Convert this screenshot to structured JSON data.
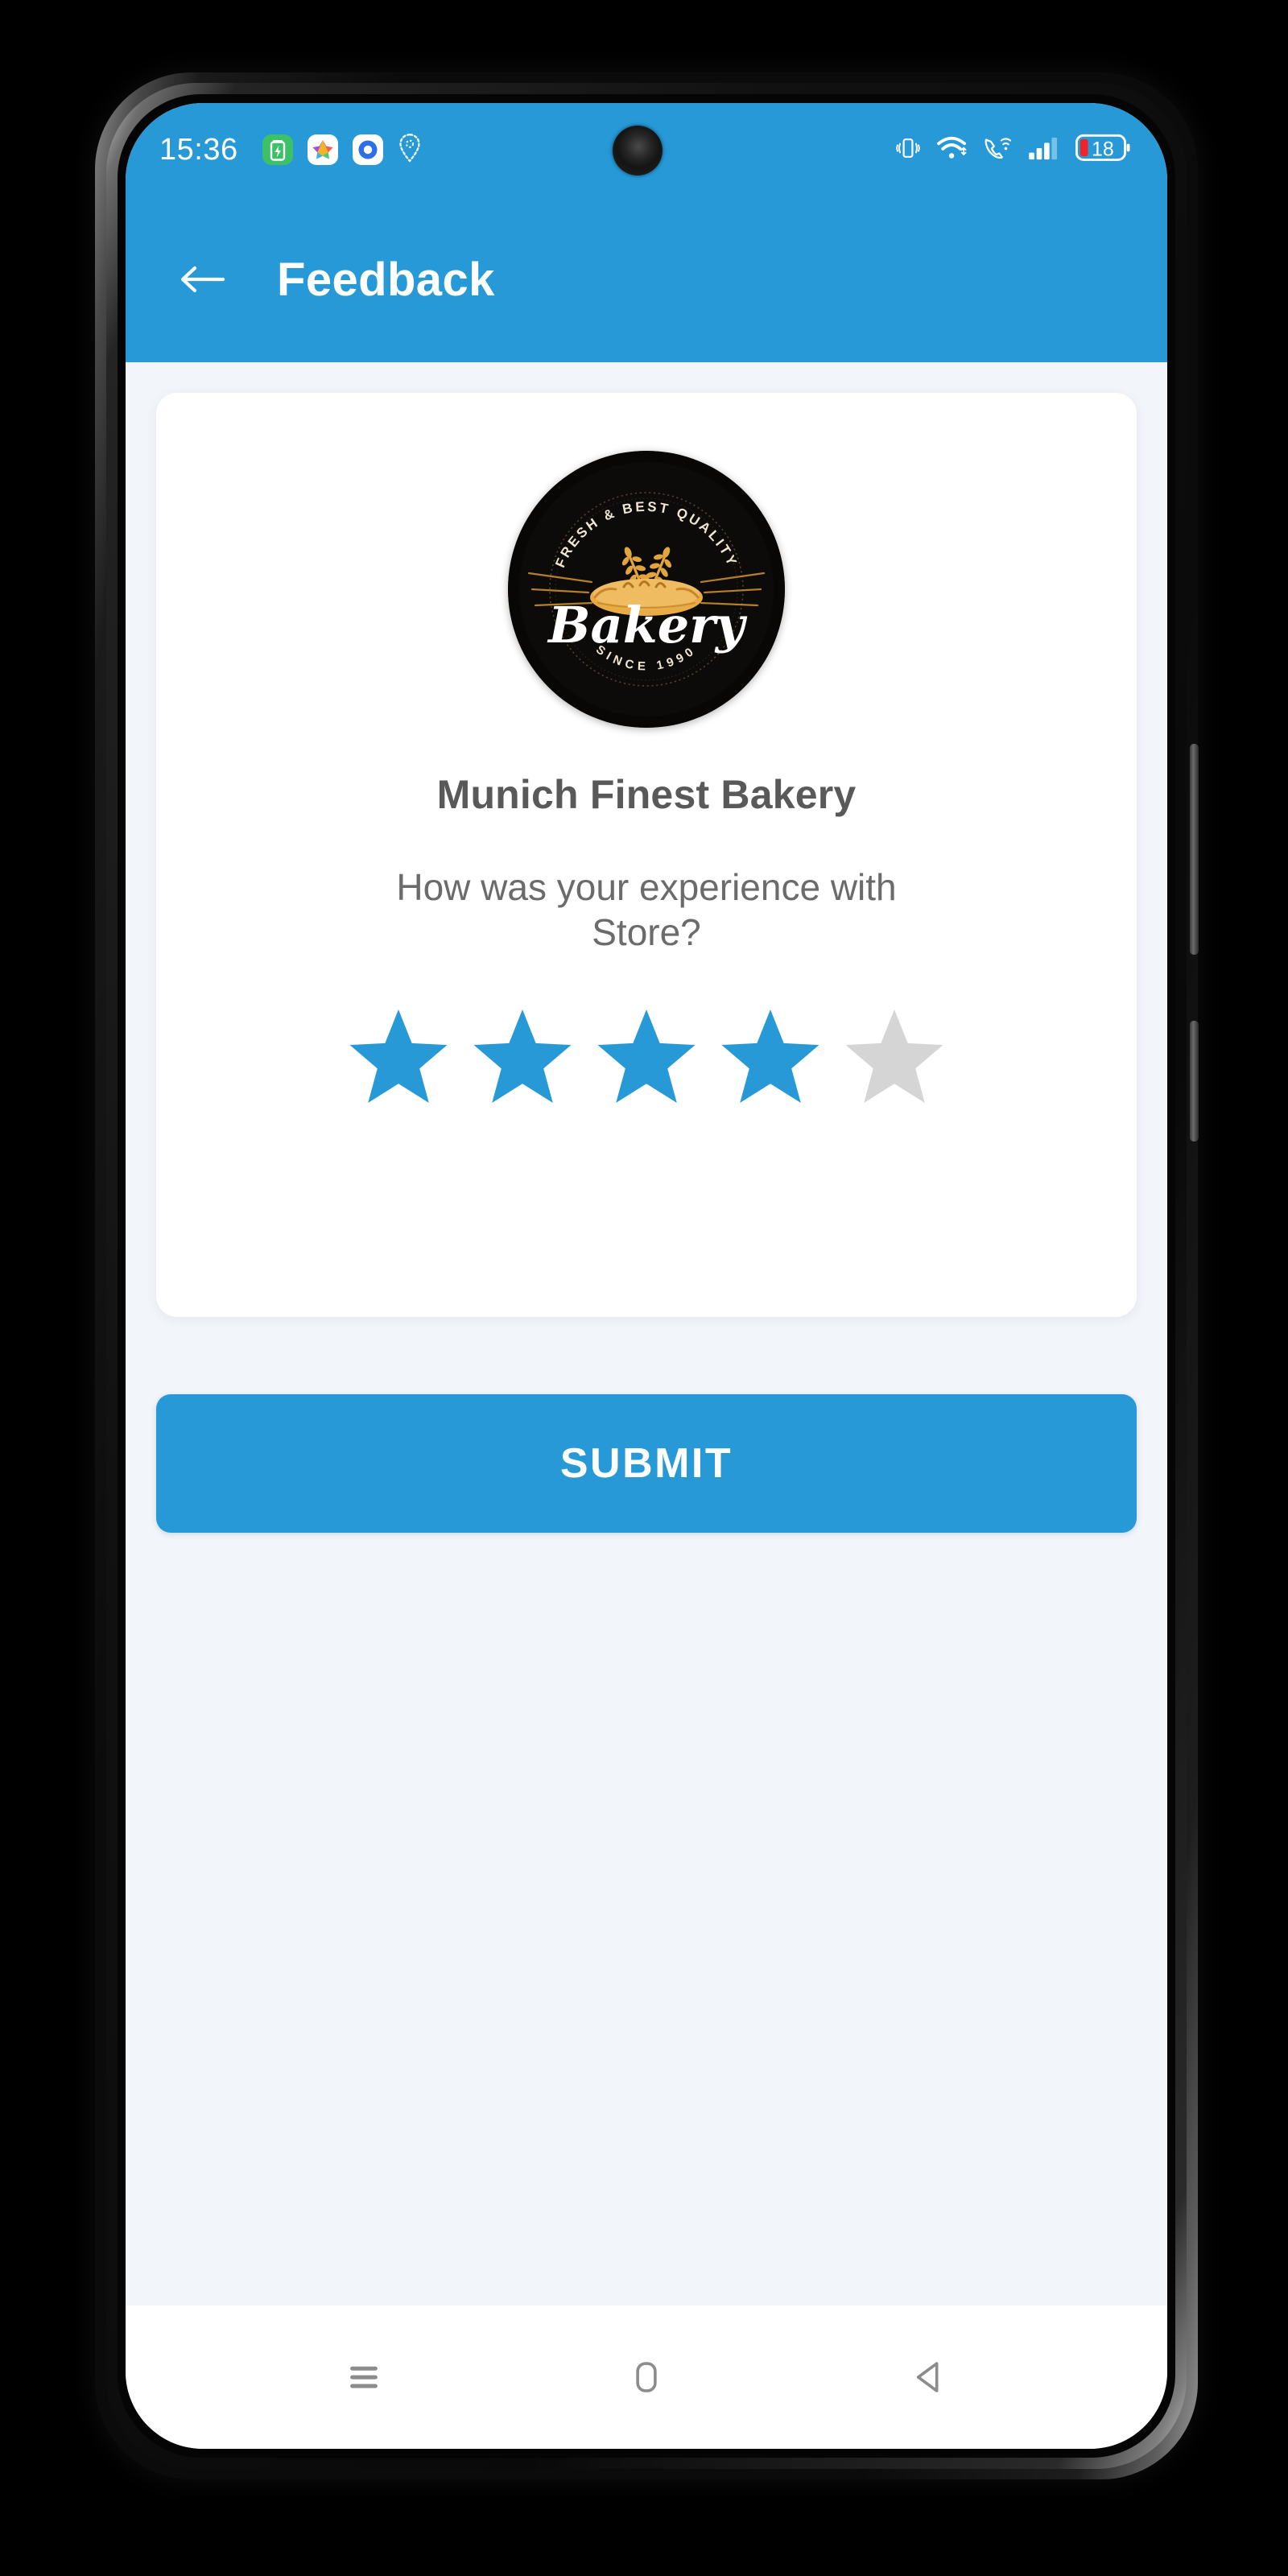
{
  "status_bar": {
    "clock": "15:36",
    "left_icons": [
      {
        "name": "battery-saver-icon",
        "label": "battery-saver"
      },
      {
        "name": "star-app-icon",
        "label": "app-star"
      },
      {
        "name": "eye-app-icon",
        "label": "app-eye"
      },
      {
        "name": "location-pin-icon",
        "label": "location"
      }
    ],
    "right_icons": [
      {
        "name": "vibrate-icon",
        "label": "vibrate"
      },
      {
        "name": "wifi-icon",
        "label": "wifi"
      },
      {
        "name": "call-wifi-icon",
        "label": "wifi-calling"
      },
      {
        "name": "signal-bars-icon",
        "label": "cellular-signal"
      }
    ],
    "battery_level": "18"
  },
  "app_bar": {
    "back_icon": "arrow-left-icon",
    "title": "Feedback"
  },
  "card": {
    "logo": {
      "name": "bakery-logo",
      "arc_top_text": "FRESH & BEST QUALITY",
      "script_text": "Bakery",
      "arc_bottom_text": "SINCE 1990"
    },
    "store_name": "Munich Finest Bakery",
    "question": "How was your experience with Store?",
    "rating": {
      "value": 4,
      "max": 5,
      "filled_color": "#2699d6",
      "empty_color": "#d5d5d5"
    }
  },
  "submit": {
    "label": "SUBMIT",
    "color": "#2699d6"
  },
  "nav_bar": {
    "recents_icon": "recents-icon",
    "home_icon": "home-icon",
    "back_icon": "back-triangle-icon"
  },
  "theme": {
    "accent": "#2699d6",
    "page_background": "#f2f5fa",
    "card_background": "#ffffff",
    "text_primary": "#595959",
    "text_secondary": "#6b6b6b"
  }
}
